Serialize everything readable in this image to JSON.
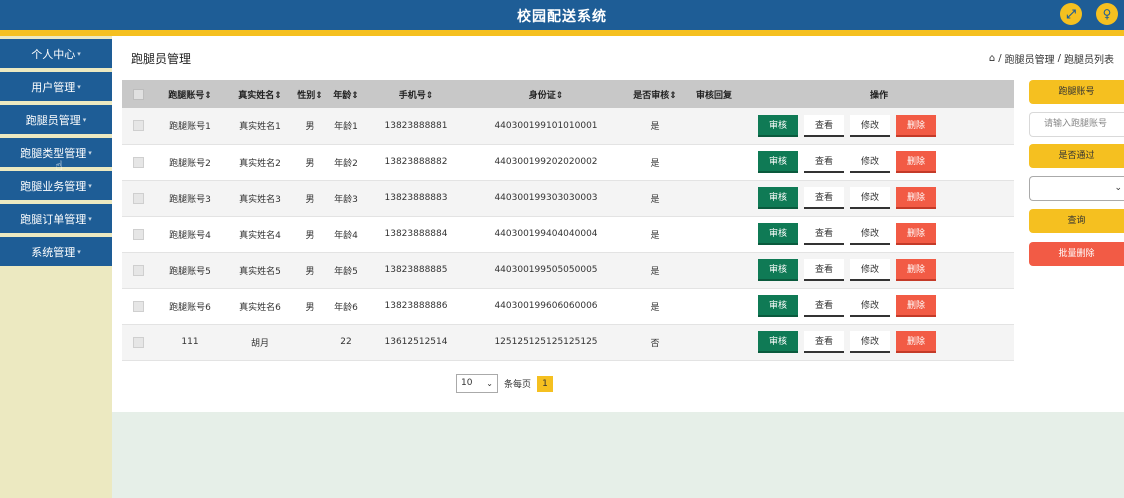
{
  "header": {
    "title": "校园配送系统",
    "fullscreen_icon": "expand-icon",
    "user_icon": "user-icon"
  },
  "sidebar": {
    "items": [
      {
        "label": "个人中心"
      },
      {
        "label": "用户管理"
      },
      {
        "label": "跑腿员管理"
      },
      {
        "label": "跑腿类型管理"
      },
      {
        "label": "跑腿业务管理"
      },
      {
        "label": "跑腿订单管理"
      },
      {
        "label": "系统管理"
      }
    ]
  },
  "main": {
    "page_title": "跑腿员管理",
    "breadcrumb": {
      "home_icon": "home-icon",
      "items": [
        "跑腿员管理",
        "跑腿员列表"
      ]
    }
  },
  "table": {
    "columns": [
      "跑腿账号",
      "真实姓名",
      "性别",
      "年龄",
      "手机号",
      "身份证",
      "是否审核",
      "审核回复",
      "操作"
    ],
    "rows": [
      {
        "account": "跑腿账号1",
        "name": "真实姓名1",
        "gender": "男",
        "age": "年龄1",
        "phone": "13823888881",
        "idcard": "440300199101010001",
        "audited": "是",
        "reply": ""
      },
      {
        "account": "跑腿账号2",
        "name": "真实姓名2",
        "gender": "男",
        "age": "年龄2",
        "phone": "13823888882",
        "idcard": "440300199202020002",
        "audited": "是",
        "reply": ""
      },
      {
        "account": "跑腿账号3",
        "name": "真实姓名3",
        "gender": "男",
        "age": "年龄3",
        "phone": "13823888883",
        "idcard": "440300199303030003",
        "audited": "是",
        "reply": ""
      },
      {
        "account": "跑腿账号4",
        "name": "真实姓名4",
        "gender": "男",
        "age": "年龄4",
        "phone": "13823888884",
        "idcard": "440300199404040004",
        "audited": "是",
        "reply": ""
      },
      {
        "account": "跑腿账号5",
        "name": "真实姓名5",
        "gender": "男",
        "age": "年龄5",
        "phone": "13823888885",
        "idcard": "440300199505050005",
        "audited": "是",
        "reply": ""
      },
      {
        "account": "跑腿账号6",
        "name": "真实姓名6",
        "gender": "男",
        "age": "年龄6",
        "phone": "13823888886",
        "idcard": "440300199606060006",
        "audited": "是",
        "reply": ""
      },
      {
        "account": "111",
        "name": "胡月",
        "gender": "",
        "age": "22",
        "phone": "13612512514",
        "idcard": "125125125125125125",
        "audited": "否",
        "reply": ""
      }
    ],
    "actions": {
      "audit": "审核",
      "view": "查看",
      "edit": "修改",
      "delete": "删除"
    },
    "colors": {
      "audit": "#0f7a55",
      "delete": "#f25b45",
      "header_bg": "#c8c8c8"
    }
  },
  "pager": {
    "page_size": "10",
    "per_page_label": "条每页",
    "current_page": "1"
  },
  "search_panel": {
    "account_label": "跑腿账号",
    "account_placeholder": "请输入跑腿账号",
    "passed_label": "是否通过",
    "passed_value": "",
    "query_button": "查询",
    "batch_delete_button": "批量删除"
  },
  "theme": {
    "primary": "#1e5d96",
    "accent": "#f5c020",
    "sidebar_bg": "#ece9c1",
    "main_bottom_bg": "#e6efe8"
  }
}
